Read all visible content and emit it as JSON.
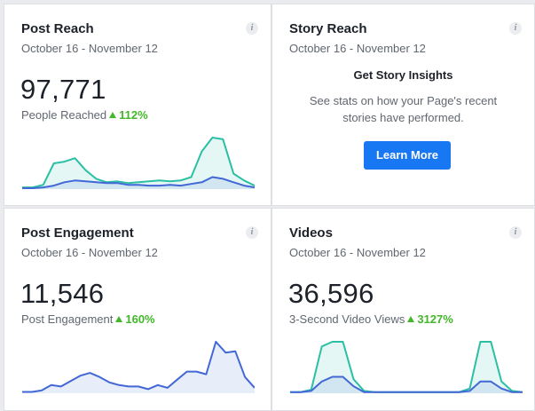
{
  "colors": {
    "teal": "#2bbfa4",
    "blue": "#4267d6",
    "green": "#42b72a",
    "button": "#1877f2"
  },
  "cards": [
    {
      "title": "Post Reach",
      "date_range": "October 16 - November 12",
      "value": "97,771",
      "metric_label": "People Reached",
      "delta": "112%",
      "info_icon": "info-icon"
    },
    {
      "title": "Story Reach",
      "date_range": "October 16 - November 12",
      "heading": "Get Story Insights",
      "body": "See stats on how your Page's recent stories have performed.",
      "button_label": "Learn More",
      "info_icon": "info-icon"
    },
    {
      "title": "Post Engagement",
      "date_range": "October 16 - November 12",
      "value": "11,546",
      "metric_label": "Post Engagement",
      "delta": "160%",
      "info_icon": "info-icon"
    },
    {
      "title": "Videos",
      "date_range": "October 16 - November 12",
      "value": "36,596",
      "metric_label": "3-Second Video Views",
      "delta": "3127%",
      "info_icon": "info-icon"
    }
  ],
  "chart_data": [
    {
      "type": "area",
      "chart": "post-reach",
      "series": [
        {
          "color": "#2bbfa4",
          "values": [
            2,
            2,
            5,
            30,
            32,
            36,
            22,
            12,
            8,
            9,
            7,
            8,
            9,
            10,
            9,
            10,
            14,
            44,
            60,
            58,
            18,
            10,
            4
          ]
        },
        {
          "color": "#4267d6",
          "values": [
            1,
            1,
            2,
            4,
            8,
            10,
            9,
            8,
            7,
            7,
            5,
            5,
            4,
            4,
            5,
            4,
            6,
            8,
            14,
            12,
            8,
            4,
            2
          ]
        }
      ]
    },
    {
      "type": "area",
      "chart": "post-engagement",
      "series": [
        {
          "color": "#4267d6",
          "values": [
            1,
            1,
            2,
            6,
            5,
            9,
            13,
            15,
            12,
            8,
            6,
            5,
            5,
            3,
            6,
            4,
            10,
            16,
            16,
            14,
            38,
            30,
            31,
            12,
            4
          ]
        }
      ]
    },
    {
      "type": "area",
      "chart": "videos",
      "series": [
        {
          "color": "#2bbfa4",
          "values": [
            1,
            1,
            3,
            40,
            44,
            44,
            12,
            2,
            1,
            1,
            1,
            1,
            1,
            1,
            1,
            1,
            1,
            4,
            44,
            44,
            10,
            2,
            1
          ]
        },
        {
          "color": "#4267d6",
          "values": [
            1,
            1,
            2,
            10,
            14,
            14,
            6,
            1,
            1,
            1,
            1,
            1,
            1,
            1,
            1,
            1,
            1,
            2,
            10,
            10,
            4,
            1,
            1
          ]
        }
      ]
    }
  ]
}
